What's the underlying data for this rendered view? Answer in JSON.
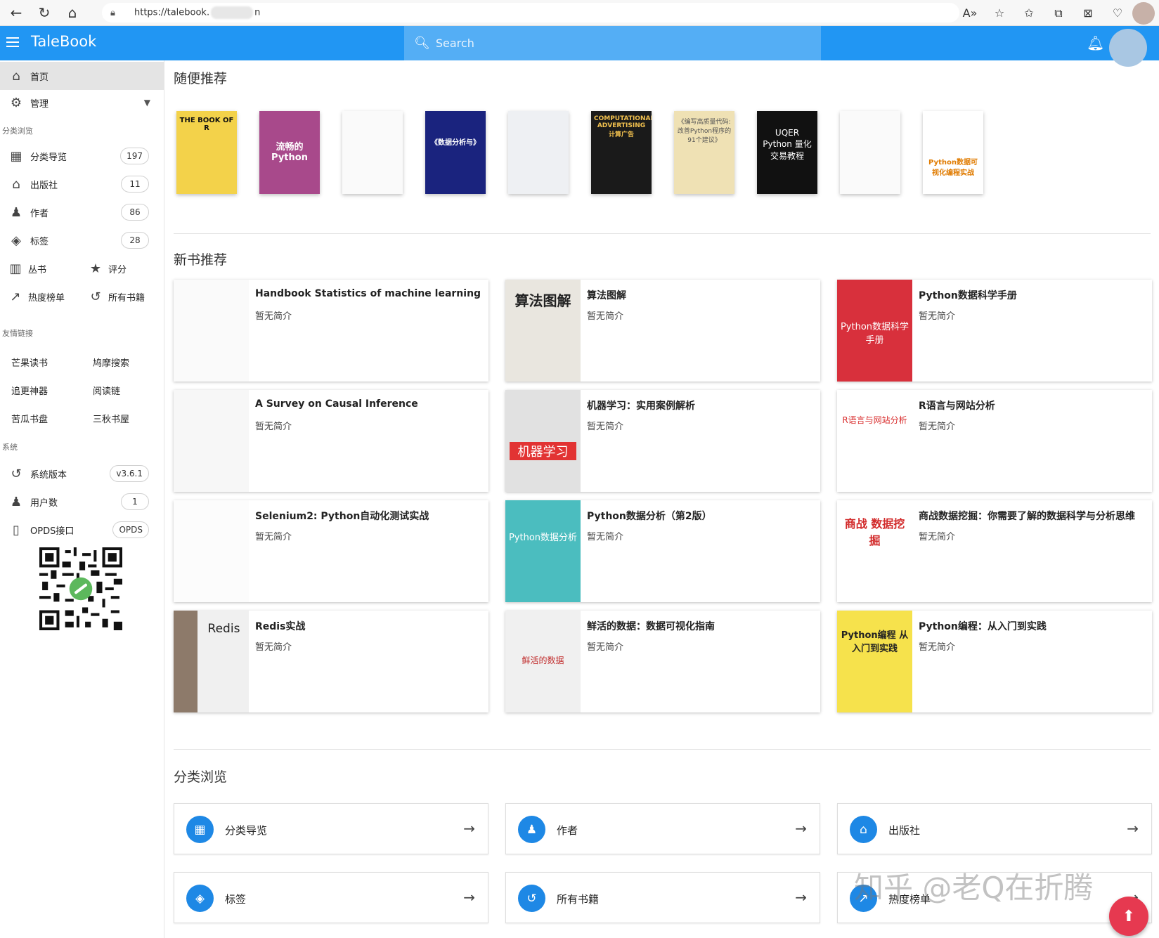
{
  "browser": {
    "url_prefix": "https://talebook.",
    "url_suffix": "n"
  },
  "appbar": {
    "title": "TaleBook",
    "search_placeholder": "Search"
  },
  "sidebar": {
    "home": "首页",
    "manage": "管理",
    "section_browse": "分类浏览",
    "categories": "分类导览",
    "categories_count": "197",
    "publishers": "出版社",
    "publishers_count": "11",
    "authors": "作者",
    "authors_count": "86",
    "tags": "标签",
    "tags_count": "28",
    "series": "丛书",
    "rating": "评分",
    "hot": "热度榜单",
    "all_books": "所有书籍",
    "section_links": "友情链接",
    "links": [
      "芒果读书",
      "鸠摩搜索",
      "追更神器",
      "阅读链",
      "苦瓜书盘",
      "三秋书屋"
    ],
    "section_system": "系统",
    "version_label": "系统版本",
    "version_value": "v3.6.1",
    "users_label": "用户数",
    "users_value": "1",
    "opds_label": "OPDS接口",
    "opds_value": "OPDS"
  },
  "main": {
    "random_title": "随便推荐",
    "random_covers": [
      {
        "text": "THE BOOK OF R",
        "bg": "#f3d24a",
        "fg": "#111"
      },
      {
        "text": "流畅的Python",
        "bg": "#a8498b",
        "fg": "#fff"
      },
      {
        "text": "",
        "bg": "#fafafa",
        "fg": "#999"
      },
      {
        "text": "《数据分析与》",
        "bg": "#1a237e",
        "fg": "#fff"
      },
      {
        "text": "",
        "bg": "#eef0f3",
        "fg": "#555"
      },
      {
        "text": "COMPUTATIONAL ADVERTISING 计算广告",
        "bg": "#1a1a1a",
        "fg": "#f2c14e"
      },
      {
        "text": "《编写高质量代码:改善Python程序的91个建议》",
        "bg": "#efe1b4",
        "fg": "#555"
      },
      {
        "text": "UQER Python 量化交易教程",
        "bg": "#111111",
        "fg": "#ffffff"
      },
      {
        "text": "",
        "bg": "#fafafa",
        "fg": "#999"
      },
      {
        "text": "Python数据可视化编程实战",
        "bg": "#ffffff",
        "fg": "#e07b00"
      }
    ],
    "new_title": "新书推荐",
    "no_desc": "暂无简介",
    "new_books": [
      {
        "title": "Handbook Statistics of machine learning",
        "cover_text": "",
        "bg": "#fafafa",
        "fg": "#999"
      },
      {
        "title": "算法图解",
        "cover_text": "算法图解",
        "bg": "#e9e6df",
        "fg": "#222"
      },
      {
        "title": "Python数据科学手册",
        "cover_text": "Python数据科学手册",
        "bg": "#d8303c",
        "fg": "#fff"
      },
      {
        "title": "A Survey on Causal Inference",
        "cover_text": "",
        "bg": "#f7f7f7",
        "fg": "#999"
      },
      {
        "title": "机器学习：实用案例解析",
        "cover_text": "机器学习",
        "bg": "#e1e1e1",
        "fg": "#ffffff"
      },
      {
        "title": "R语言与网站分析",
        "cover_text": "R语言与网站分析",
        "bg": "#ffffff",
        "fg": "#d82c2c"
      },
      {
        "title": "Selenium2: Python自动化测试实战",
        "cover_text": "",
        "bg": "#fcfcfc",
        "fg": "#999"
      },
      {
        "title": "Python数据分析（第2版）",
        "cover_text": "Python数据分析",
        "bg": "#4bbdbf",
        "fg": "#ffffff"
      },
      {
        "title": "商战数据挖掘：你需要了解的数据科学与分析思维",
        "cover_text": "商战 数据挖掘",
        "bg": "#ffffff",
        "fg": "#d22a2a"
      },
      {
        "title": "Redis实战",
        "cover_text": "Redis",
        "bg": "#ececec",
        "fg": "#222"
      },
      {
        "title": "鲜活的数据：数据可视化指南",
        "cover_text": "鲜活的数据",
        "bg": "#f0f0f0",
        "fg": "#c02b2b"
      },
      {
        "title": "Python编程：从入门到实践",
        "cover_text": "Python编程 从入门到实践",
        "bg": "#f6e24c",
        "fg": "#222"
      }
    ],
    "cat_title": "分类浏览",
    "cat_cards": [
      {
        "label": "分类导览",
        "icon": "▦"
      },
      {
        "label": "作者",
        "icon": "♟"
      },
      {
        "label": "出版社",
        "icon": "⌂"
      },
      {
        "label": "标签",
        "icon": "◈"
      },
      {
        "label": "所有书籍",
        "icon": "↺"
      },
      {
        "label": "热度榜单",
        "icon": "↗"
      }
    ]
  },
  "watermark": "知乎 @老Q在折腾",
  "colors": {
    "primary": "#2196f3",
    "accent": "#e63950",
    "icon_blue": "#1e88e5"
  }
}
